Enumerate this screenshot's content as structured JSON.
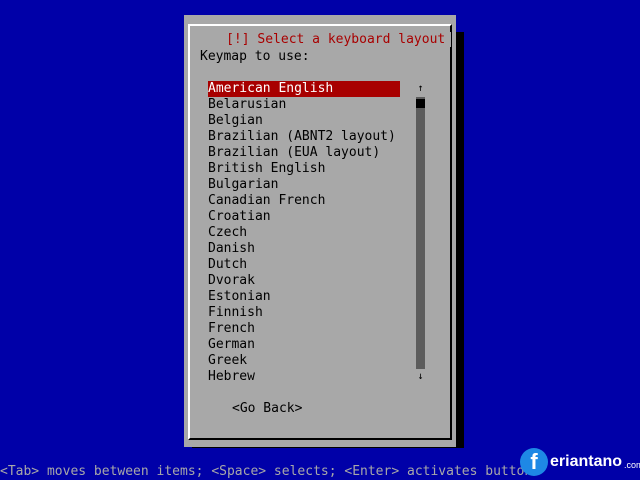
{
  "dialog": {
    "title": "[!] Select a keyboard layout",
    "prompt": "Keymap to use:",
    "items": [
      {
        "label": "American English",
        "selected": true
      },
      {
        "label": "Belarusian"
      },
      {
        "label": "Belgian"
      },
      {
        "label": "Brazilian (ABNT2 layout)"
      },
      {
        "label": "Brazilian (EUA layout)"
      },
      {
        "label": "British English"
      },
      {
        "label": "Bulgarian"
      },
      {
        "label": "Canadian French"
      },
      {
        "label": "Croatian"
      },
      {
        "label": "Czech"
      },
      {
        "label": "Danish"
      },
      {
        "label": "Dutch"
      },
      {
        "label": "Dvorak"
      },
      {
        "label": "Estonian"
      },
      {
        "label": "Finnish"
      },
      {
        "label": "French"
      },
      {
        "label": "German"
      },
      {
        "label": "Greek"
      },
      {
        "label": "Hebrew"
      }
    ],
    "scroll_up": "↑",
    "scroll_down": "↓",
    "go_back": "<Go Back>"
  },
  "status_bar": "<Tab> moves between items; <Space> selects; <Enter> activates buttons",
  "watermark": {
    "icon": "f",
    "text": "eriantano",
    "suffix": ".com"
  },
  "colors": {
    "background": "#0000a8",
    "dialog": "#a8a8a8",
    "selected": "#a80000",
    "title": "#a80000"
  }
}
